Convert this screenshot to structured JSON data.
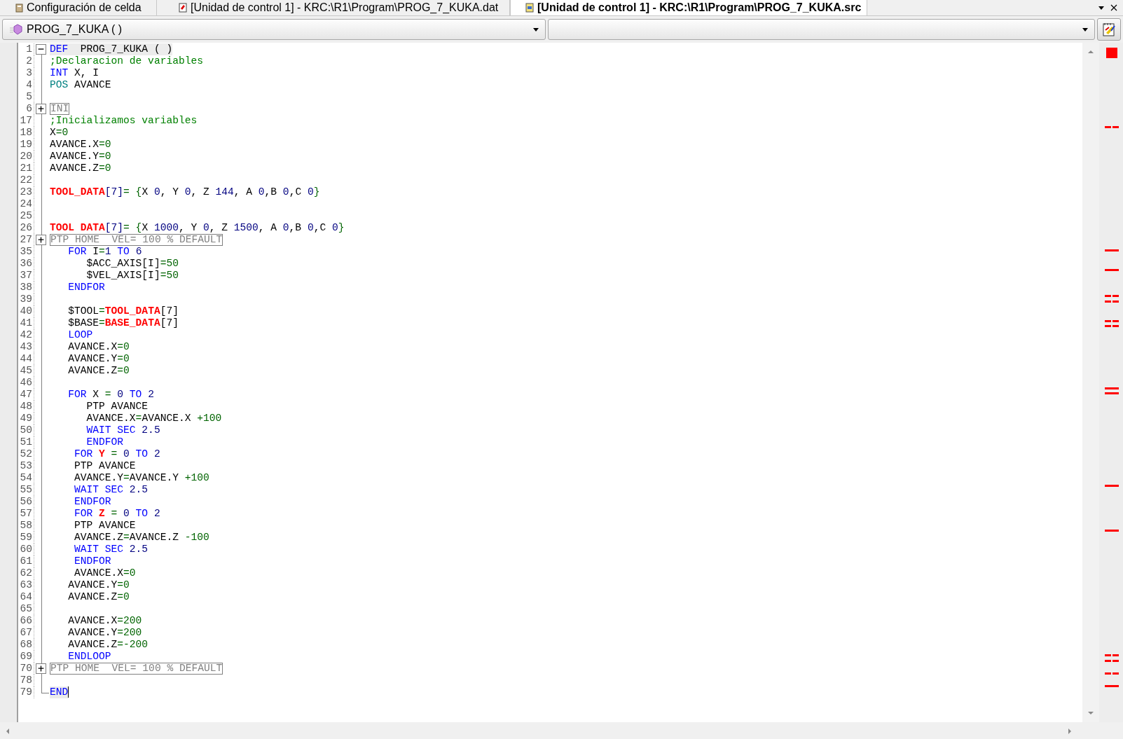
{
  "tabs": [
    {
      "kind": "cell",
      "label": "Configuración de celda",
      "selected": false
    },
    {
      "kind": "dat",
      "label": "[Unidad de control 1] - KRC:\\R1\\Program\\PROG_7_KUKA.dat",
      "selected": false
    },
    {
      "kind": "src",
      "label": "[Unidad de control 1] - KRC:\\R1\\Program\\PROG_7_KUKA.src",
      "selected": true
    }
  ],
  "toolbar": {
    "module_combo": "PROG_7_KUKA ( )"
  },
  "lines": [
    {
      "number": "1",
      "kind": "fold-open",
      "highlighted": true,
      "caret": false,
      "tokens": [
        {
          "kind": "keyword",
          "text": "DEF"
        },
        {
          "kind": "plain",
          "text": "  PROG_7_KUKA ( )"
        }
      ]
    },
    {
      "number": "2",
      "kind": "code",
      "highlighted": false,
      "caret": false,
      "tokens": [
        {
          "kind": "comment",
          "text": ";Declaracion de variables"
        }
      ]
    },
    {
      "number": "3",
      "kind": "code",
      "highlighted": false,
      "caret": false,
      "tokens": [
        {
          "kind": "keyword",
          "text": "INT"
        },
        {
          "kind": "plain",
          "text": " X, I"
        }
      ]
    },
    {
      "number": "4",
      "kind": "code",
      "highlighted": false,
      "caret": false,
      "tokens": [
        {
          "kind": "type",
          "text": "POS"
        },
        {
          "kind": "plain",
          "text": " AVANCE"
        }
      ]
    },
    {
      "number": "5",
      "kind": "code",
      "highlighted": false,
      "caret": false
    },
    {
      "number": "6",
      "kind": "fold-closed",
      "highlighted": false,
      "caret": false,
      "tokens": [
        {
          "kind": "folded",
          "text": "INI"
        }
      ]
    },
    {
      "number": "17",
      "kind": "code",
      "highlighted": false,
      "caret": false,
      "tokens": [
        {
          "kind": "comment",
          "text": ";Inicializamos variables"
        }
      ]
    },
    {
      "number": "18",
      "kind": "code",
      "highlighted": false,
      "caret": false,
      "tokens": [
        {
          "kind": "plain",
          "text": "X"
        },
        {
          "kind": "operator",
          "text": "=0"
        }
      ]
    },
    {
      "number": "19",
      "kind": "code",
      "highlighted": false,
      "caret": false,
      "tokens": [
        {
          "kind": "plain",
          "text": "AVANCE.X"
        },
        {
          "kind": "operator",
          "text": "=0"
        }
      ]
    },
    {
      "number": "20",
      "kind": "code",
      "highlighted": false,
      "caret": false,
      "tokens": [
        {
          "kind": "plain",
          "text": "AVANCE.Y"
        },
        {
          "kind": "operator",
          "text": "=0"
        }
      ]
    },
    {
      "number": "21",
      "kind": "code",
      "highlighted": false,
      "caret": false,
      "tokens": [
        {
          "kind": "plain",
          "text": "AVANCE.Z"
        },
        {
          "kind": "operator",
          "text": "=0"
        }
      ]
    },
    {
      "number": "22",
      "kind": "code",
      "highlighted": false,
      "caret": false
    },
    {
      "number": "23",
      "kind": "code",
      "highlighted": false,
      "caret": false,
      "tokens": [
        {
          "kind": "error",
          "text": "TOOL_DATA"
        },
        {
          "kind": "number",
          "text": "[7]"
        },
        {
          "kind": "operator",
          "text": "= {"
        },
        {
          "kind": "plain",
          "text": "X "
        },
        {
          "kind": "number",
          "text": "0"
        },
        {
          "kind": "plain",
          "text": ", Y "
        },
        {
          "kind": "number",
          "text": "0"
        },
        {
          "kind": "plain",
          "text": ", Z "
        },
        {
          "kind": "number",
          "text": "144"
        },
        {
          "kind": "plain",
          "text": ", A "
        },
        {
          "kind": "number",
          "text": "0"
        },
        {
          "kind": "plain",
          "text": ",B "
        },
        {
          "kind": "number",
          "text": "0"
        },
        {
          "kind": "plain",
          "text": ",C "
        },
        {
          "kind": "number",
          "text": "0"
        },
        {
          "kind": "operator",
          "text": "}"
        }
      ]
    },
    {
      "number": "24",
      "kind": "code",
      "highlighted": false,
      "caret": false
    },
    {
      "number": "25",
      "kind": "code",
      "highlighted": false,
      "caret": false
    },
    {
      "number": "26",
      "kind": "code",
      "highlighted": false,
      "caret": false,
      "tokens": [
        {
          "kind": "error",
          "text": "TOOL DATA"
        },
        {
          "kind": "number",
          "text": "[7]"
        },
        {
          "kind": "operator",
          "text": "= {"
        },
        {
          "kind": "plain",
          "text": "X "
        },
        {
          "kind": "number",
          "text": "1000"
        },
        {
          "kind": "plain",
          "text": ", Y "
        },
        {
          "kind": "number",
          "text": "0"
        },
        {
          "kind": "plain",
          "text": ", Z "
        },
        {
          "kind": "number",
          "text": "1500"
        },
        {
          "kind": "plain",
          "text": ", A "
        },
        {
          "kind": "number",
          "text": "0"
        },
        {
          "kind": "plain",
          "text": ",B "
        },
        {
          "kind": "number",
          "text": "0"
        },
        {
          "kind": "plain",
          "text": ",C "
        },
        {
          "kind": "number",
          "text": "0"
        },
        {
          "kind": "operator",
          "text": "}"
        }
      ]
    },
    {
      "number": "27",
      "kind": "fold-closed",
      "highlighted": false,
      "caret": false,
      "tokens": [
        {
          "kind": "folded",
          "text": "PTP HOME  VEL= 100 % DEFAULT"
        }
      ]
    },
    {
      "number": "35",
      "kind": "code",
      "highlighted": false,
      "caret": false,
      "tokens": [
        {
          "kind": "keyword",
          "text": "   FOR"
        },
        {
          "kind": "plain",
          "text": " I"
        },
        {
          "kind": "operator",
          "text": "="
        },
        {
          "kind": "number",
          "text": "1"
        },
        {
          "kind": "keyword",
          "text": " TO "
        },
        {
          "kind": "number",
          "text": "6"
        }
      ]
    },
    {
      "number": "36",
      "kind": "code",
      "highlighted": false,
      "caret": false,
      "tokens": [
        {
          "kind": "plain",
          "text": "      $ACC_AXIS[I]"
        },
        {
          "kind": "operator",
          "text": "=50"
        }
      ]
    },
    {
      "number": "37",
      "kind": "code",
      "highlighted": false,
      "caret": false,
      "tokens": [
        {
          "kind": "plain",
          "text": "      $VEL_AXIS[I]"
        },
        {
          "kind": "operator",
          "text": "=50"
        }
      ]
    },
    {
      "number": "38",
      "kind": "code",
      "highlighted": false,
      "caret": false,
      "tokens": [
        {
          "kind": "keyword",
          "text": "   ENDFOR"
        }
      ]
    },
    {
      "number": "39",
      "kind": "code",
      "highlighted": false,
      "caret": false
    },
    {
      "number": "40",
      "kind": "code",
      "highlighted": false,
      "caret": false,
      "tokens": [
        {
          "kind": "plain",
          "text": "   $TOOL"
        },
        {
          "kind": "operator",
          "text": "="
        },
        {
          "kind": "error",
          "text": "TOOL_DATA"
        },
        {
          "kind": "plain",
          "text": "[7]"
        }
      ]
    },
    {
      "number": "41",
      "kind": "code",
      "highlighted": false,
      "caret": false,
      "tokens": [
        {
          "kind": "plain",
          "text": "   $BASE"
        },
        {
          "kind": "operator",
          "text": "="
        },
        {
          "kind": "error",
          "text": "BASE_DATA"
        },
        {
          "kind": "plain",
          "text": "[7]"
        }
      ]
    },
    {
      "number": "42",
      "kind": "code",
      "highlighted": false,
      "caret": false,
      "tokens": [
        {
          "kind": "keyword",
          "text": "   LOOP"
        }
      ]
    },
    {
      "number": "43",
      "kind": "code",
      "highlighted": false,
      "caret": false,
      "tokens": [
        {
          "kind": "plain",
          "text": "   AVANCE.X"
        },
        {
          "kind": "operator",
          "text": "=0"
        }
      ]
    },
    {
      "number": "44",
      "kind": "code",
      "highlighted": false,
      "caret": false,
      "tokens": [
        {
          "kind": "plain",
          "text": "   AVANCE.Y"
        },
        {
          "kind": "operator",
          "text": "=0"
        }
      ]
    },
    {
      "number": "45",
      "kind": "code",
      "highlighted": false,
      "caret": false,
      "tokens": [
        {
          "kind": "plain",
          "text": "   AVANCE.Z"
        },
        {
          "kind": "operator",
          "text": "=0"
        }
      ]
    },
    {
      "number": "46",
      "kind": "code",
      "highlighted": false,
      "caret": false
    },
    {
      "number": "47",
      "kind": "code",
      "highlighted": false,
      "caret": false,
      "tokens": [
        {
          "kind": "keyword",
          "text": "   FOR"
        },
        {
          "kind": "plain",
          "text": " X "
        },
        {
          "kind": "operator",
          "text": "="
        },
        {
          "kind": "number",
          "text": " 0"
        },
        {
          "kind": "keyword",
          "text": " TO "
        },
        {
          "kind": "number",
          "text": "2"
        }
      ]
    },
    {
      "number": "48",
      "kind": "code",
      "highlighted": false,
      "caret": false,
      "tokens": [
        {
          "kind": "plain",
          "text": "      PTP AVANCE"
        }
      ]
    },
    {
      "number": "49",
      "kind": "code",
      "highlighted": false,
      "caret": false,
      "tokens": [
        {
          "kind": "plain",
          "text": "      AVANCE.X"
        },
        {
          "kind": "operator",
          "text": "="
        },
        {
          "kind": "plain",
          "text": "AVANCE.X "
        },
        {
          "kind": "operator",
          "text": "+100"
        }
      ]
    },
    {
      "number": "50",
      "kind": "code",
      "highlighted": false,
      "caret": false,
      "tokens": [
        {
          "kind": "keyword",
          "text": "      WAIT SEC"
        },
        {
          "kind": "number",
          "text": " 2.5"
        }
      ]
    },
    {
      "number": "51",
      "kind": "code",
      "highlighted": false,
      "caret": false,
      "tokens": [
        {
          "kind": "keyword",
          "text": "      ENDFOR"
        }
      ]
    },
    {
      "number": "52",
      "kind": "code",
      "highlighted": false,
      "caret": false,
      "tokens": [
        {
          "kind": "keyword",
          "text": "    FOR"
        },
        {
          "kind": "error",
          "text": " Y"
        },
        {
          "kind": "operator",
          "text": " ="
        },
        {
          "kind": "number",
          "text": " 0"
        },
        {
          "kind": "keyword",
          "text": " TO "
        },
        {
          "kind": "number",
          "text": "2"
        }
      ]
    },
    {
      "number": "53",
      "kind": "code",
      "highlighted": false,
      "caret": false,
      "tokens": [
        {
          "kind": "plain",
          "text": "    PTP AVANCE"
        }
      ]
    },
    {
      "number": "54",
      "kind": "code",
      "highlighted": false,
      "caret": false,
      "tokens": [
        {
          "kind": "plain",
          "text": "    AVANCE.Y"
        },
        {
          "kind": "operator",
          "text": "="
        },
        {
          "kind": "plain",
          "text": "AVANCE.Y "
        },
        {
          "kind": "operator",
          "text": "+100"
        }
      ]
    },
    {
      "number": "55",
      "kind": "code",
      "highlighted": false,
      "caret": false,
      "tokens": [
        {
          "kind": "keyword",
          "text": "    WAIT SEC"
        },
        {
          "kind": "number",
          "text": " 2.5"
        }
      ]
    },
    {
      "number": "56",
      "kind": "code",
      "highlighted": false,
      "caret": false,
      "tokens": [
        {
          "kind": "keyword",
          "text": "    ENDFOR"
        }
      ]
    },
    {
      "number": "57",
      "kind": "code",
      "highlighted": false,
      "caret": false,
      "tokens": [
        {
          "kind": "keyword",
          "text": "    FOR"
        },
        {
          "kind": "error",
          "text": " Z"
        },
        {
          "kind": "operator",
          "text": " ="
        },
        {
          "kind": "number",
          "text": " 0"
        },
        {
          "kind": "keyword",
          "text": " TO "
        },
        {
          "kind": "number",
          "text": "2"
        }
      ]
    },
    {
      "number": "58",
      "kind": "code",
      "highlighted": false,
      "caret": false,
      "tokens": [
        {
          "kind": "plain",
          "text": "    PTP AVANCE"
        }
      ]
    },
    {
      "number": "59",
      "kind": "code",
      "highlighted": false,
      "caret": false,
      "tokens": [
        {
          "kind": "plain",
          "text": "    AVANCE.Z"
        },
        {
          "kind": "operator",
          "text": "="
        },
        {
          "kind": "plain",
          "text": "AVANCE.Z "
        },
        {
          "kind": "operator",
          "text": "-100"
        }
      ]
    },
    {
      "number": "60",
      "kind": "code",
      "highlighted": false,
      "caret": false,
      "tokens": [
        {
          "kind": "keyword",
          "text": "    WAIT SEC"
        },
        {
          "kind": "number",
          "text": " 2.5"
        }
      ]
    },
    {
      "number": "61",
      "kind": "code",
      "highlighted": false,
      "caret": false,
      "tokens": [
        {
          "kind": "keyword",
          "text": "    ENDFOR"
        }
      ]
    },
    {
      "number": "62",
      "kind": "code",
      "highlighted": false,
      "caret": false,
      "tokens": [
        {
          "kind": "plain",
          "text": "    AVANCE.X"
        },
        {
          "kind": "operator",
          "text": "=0"
        }
      ]
    },
    {
      "number": "63",
      "kind": "code",
      "highlighted": false,
      "caret": false,
      "tokens": [
        {
          "kind": "plain",
          "text": "   AVANCE.Y"
        },
        {
          "kind": "operator",
          "text": "=0"
        }
      ]
    },
    {
      "number": "64",
      "kind": "code",
      "highlighted": false,
      "caret": false,
      "tokens": [
        {
          "kind": "plain",
          "text": "   AVANCE.Z"
        },
        {
          "kind": "operator",
          "text": "=0"
        }
      ]
    },
    {
      "number": "65",
      "kind": "code",
      "highlighted": false,
      "caret": false
    },
    {
      "number": "66",
      "kind": "code",
      "highlighted": false,
      "caret": false,
      "tokens": [
        {
          "kind": "plain",
          "text": "   AVANCE.X"
        },
        {
          "kind": "operator",
          "text": "=200"
        }
      ]
    },
    {
      "number": "67",
      "kind": "code",
      "highlighted": false,
      "caret": false,
      "tokens": [
        {
          "kind": "plain",
          "text": "   AVANCE.Y"
        },
        {
          "kind": "operator",
          "text": "=200"
        }
      ]
    },
    {
      "number": "68",
      "kind": "code",
      "highlighted": false,
      "caret": false,
      "tokens": [
        {
          "kind": "plain",
          "text": "   AVANCE.Z"
        },
        {
          "kind": "operator",
          "text": "=-200"
        }
      ]
    },
    {
      "number": "69",
      "kind": "code",
      "highlighted": false,
      "caret": false,
      "tokens": [
        {
          "kind": "keyword",
          "text": "   ENDLOOP"
        }
      ]
    },
    {
      "number": "70",
      "kind": "fold-closed",
      "highlighted": false,
      "caret": false,
      "tokens": [
        {
          "kind": "folded",
          "text": "PTP HOME  VEL= 100 % DEFAULT"
        }
      ]
    },
    {
      "number": "78",
      "kind": "code",
      "highlighted": false,
      "caret": false
    },
    {
      "number": "79",
      "kind": "fold-end",
      "highlighted": true,
      "caret": true,
      "tokens": [
        {
          "kind": "keyword",
          "text": "END"
        }
      ]
    }
  ]
}
